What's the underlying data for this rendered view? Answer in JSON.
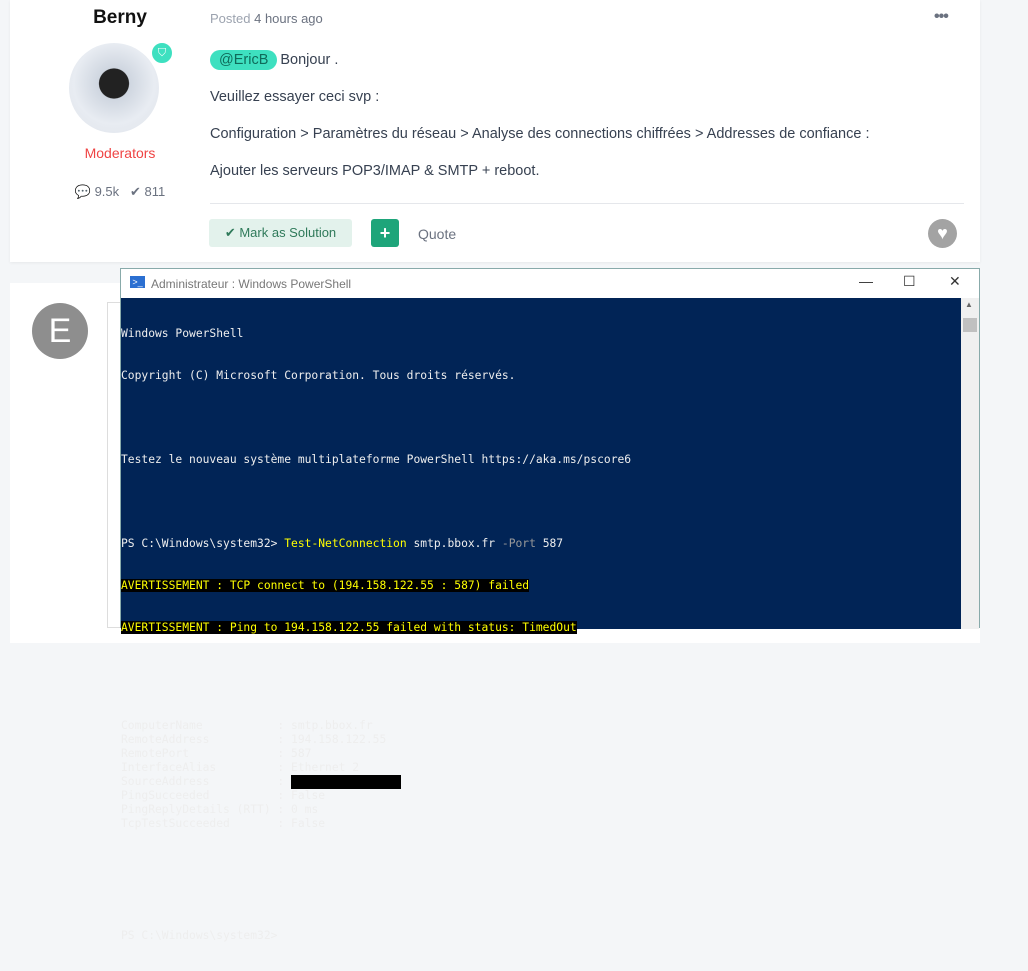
{
  "post": {
    "author": "Berny",
    "role": "Moderators",
    "posts_count": "9.5k",
    "solutions_count": "811",
    "posted_label": "Posted",
    "posted_time": "4 hours ago",
    "mention": "@EricB",
    "lines": [
      "Bonjour .",
      "Veuillez essayer ceci svp :",
      "Configuration > Paramètres du réseau > Analyse des connections chiffrées > Addresses de confiance :",
      "Ajouter les serveurs POP3/IMAP & SMTP + reboot."
    ],
    "mark_solution": "Mark as Solution",
    "quote": "Quote"
  },
  "reply": {
    "avatar_letter": "E"
  },
  "powershell": {
    "title": "Administrateur : Windows PowerShell",
    "header": [
      "Windows PowerShell",
      "Copyright (C) Microsoft Corporation. Tous droits réservés.",
      "",
      "Testez le nouveau système multiplateforme PowerShell https://aka.ms/pscore6",
      ""
    ],
    "prompt": "PS C:\\Windows\\system32> ",
    "cmd": "Test-NetConnection",
    "arg": " smtp.bbox.fr ",
    "param": "-Port",
    "port": " 587",
    "warnings": [
      "AVERTISSEMENT : TCP connect to (194.158.122.55 : 587) failed",
      "AVERTISSEMENT : Ping to 194.158.122.55 failed with status: TimedOut"
    ],
    "results": [
      {
        "k": "ComputerName           : ",
        "v": "smtp.bbox.fr"
      },
      {
        "k": "RemoteAddress          : ",
        "v": "194.158.122.55"
      },
      {
        "k": "RemotePort             : ",
        "v": "587"
      },
      {
        "k": "InterfaceAlias         : ",
        "v": "Ethernet 2"
      },
      {
        "k": "SourceAddress          : ",
        "v": ""
      },
      {
        "k": "PingSucceeded          : ",
        "v": "False"
      },
      {
        "k": "PingReplyDetails (RTT) : ",
        "v": "0 ms"
      },
      {
        "k": "TcpTestSucceeded       : ",
        "v": "False"
      }
    ],
    "final_prompt": "PS C:\\Windows\\system32>"
  }
}
